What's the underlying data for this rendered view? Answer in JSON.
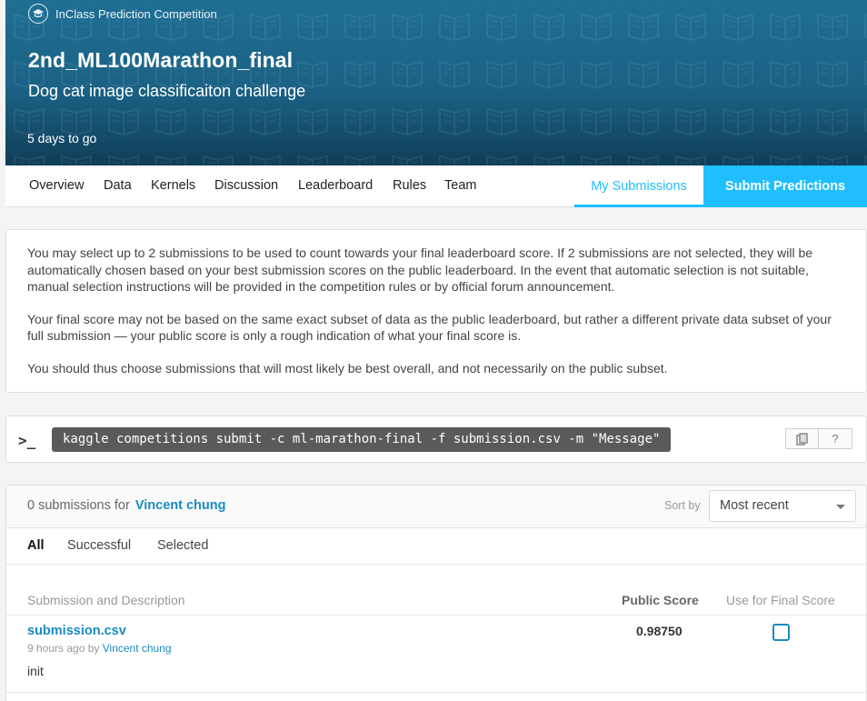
{
  "banner": {
    "competition_type": "InClass Prediction Competition",
    "title": "2nd_ML100Marathon_final",
    "subtitle": "Dog cat image classificaiton challenge",
    "deadline": "5 days to go"
  },
  "nav": {
    "items": [
      "Overview",
      "Data",
      "Kernels",
      "Discussion",
      "Leaderboard",
      "Rules",
      "Team"
    ],
    "my_submissions": "My Submissions",
    "submit_predictions": "Submit Predictions"
  },
  "info": {
    "paragraphs": [
      "You may select up to 2 submissions to be used to count towards your final leaderboard score. If 2 submissions are not selected, they will be automatically chosen based on your best submission scores on the public leaderboard. In the event that automatic selection is not suitable, manual selection instructions will be provided in the competition rules or by official forum announcement.",
      "Your final score may not be based on the same exact subset of data as the public leaderboard, but rather a different private data subset of your full submission — your public score is only a rough indication of what your final score is.",
      "You should thus choose submissions that will most likely be best overall, and not necessarily on the public subset."
    ]
  },
  "command": {
    "prompt": ">_",
    "text": "kaggle competitions submit -c ml-marathon-final -f submission.csv -m \"Message\"",
    "help": "?"
  },
  "submissions": {
    "count_text": "0 submissions for",
    "user": "Vincent chung",
    "sort_label": "Sort by",
    "sort_value": "Most recent",
    "filters": [
      "All",
      "Successful",
      "Selected"
    ],
    "columns": {
      "description": "Submission and Description",
      "public_score": "Public Score",
      "final": "Use for Final Score"
    },
    "rows": [
      {
        "file": "submission.csv",
        "time": "9 hours ago by",
        "user": "Vincent chung",
        "description": "init",
        "score": "0.98750"
      }
    ]
  },
  "colors": {
    "accent": "#20beff",
    "link": "#1a8bc0",
    "banner": "#1b6184"
  }
}
